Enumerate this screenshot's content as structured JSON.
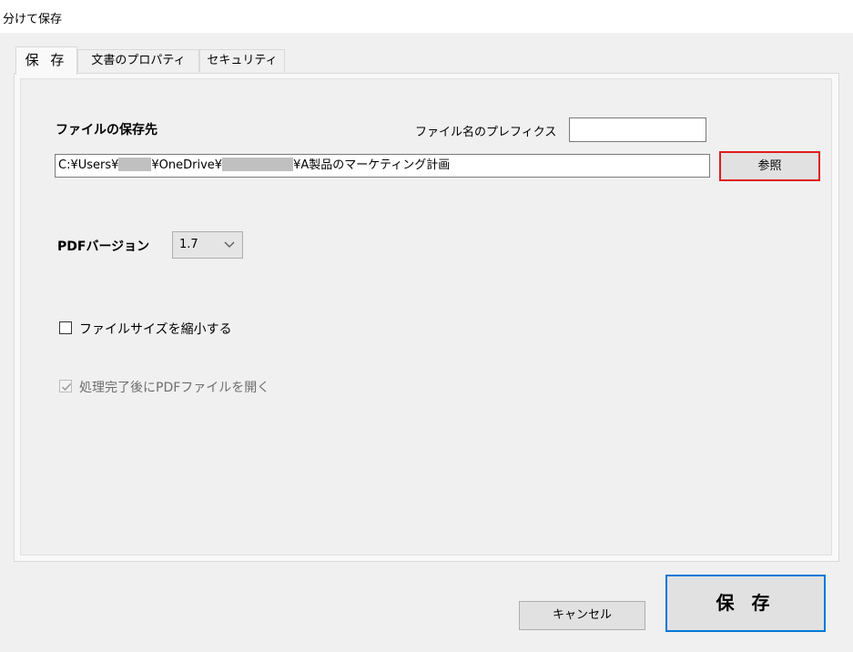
{
  "window": {
    "title": "分けて保存"
  },
  "tabs": [
    {
      "label": "保 存"
    },
    {
      "label": "文書のプロパティ"
    },
    {
      "label": "セキュリティ"
    }
  ],
  "save_tab": {
    "dest_label": "ファイルの保存先",
    "prefix_label": "ファイル名のプレフィクス",
    "prefix_value": "",
    "path_parts": [
      "C:¥Users¥",
      "¥OneDrive¥",
      "¥A製品のマーケティング計画"
    ],
    "browse_label": "参照",
    "pdf_version_label": "PDFバージョン",
    "pdf_version_value": "1.7",
    "reduce_size_label": "ファイルサイズを縮小する",
    "reduce_size_checked": false,
    "open_after_label": "処理完了後にPDFファイルを開く",
    "open_after_checked": true,
    "open_after_enabled": false
  },
  "footer": {
    "cancel_label": "キャンセル",
    "save_label": "保 存"
  },
  "colors": {
    "highlight": "#e01b1b",
    "primary_border": "#0078d7"
  }
}
